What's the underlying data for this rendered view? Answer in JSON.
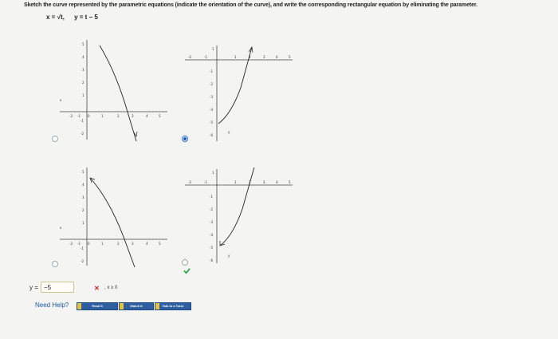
{
  "question": {
    "prompt": "Sketch the curve represented by the parametric equations (indicate the orientation of the curve), and write the corresponding rectangular equation by eliminating the parameter.",
    "eq_x": "x = √t,",
    "eq_y": "y = t − 5"
  },
  "graphs": [
    {
      "id": "A",
      "selected": false,
      "x_ticks": [
        "-2",
        "-1",
        "0",
        "1",
        "2",
        "3",
        "4",
        "5"
      ],
      "y_ticks": [
        "5",
        "4",
        "3",
        "2",
        "1",
        "-1",
        "-2"
      ],
      "x_axis_label": "x",
      "y_axis_label": "y"
    },
    {
      "id": "B",
      "selected": true,
      "x_ticks": [
        "-2",
        "-1",
        "1",
        "2",
        "3",
        "4",
        "5"
      ],
      "y_ticks": [
        "1",
        "-1",
        "-2",
        "-3",
        "-4",
        "-5",
        "-6"
      ],
      "x_axis_label": "x",
      "y_axis_label": "y"
    },
    {
      "id": "C",
      "selected": false,
      "x_ticks": [
        "-2",
        "-1",
        "0",
        "1",
        "2",
        "3",
        "4",
        "5"
      ],
      "y_ticks": [
        "5",
        "4",
        "3",
        "2",
        "1",
        "-1",
        "-2"
      ],
      "x_axis_label": "x",
      "y_axis_label": "y"
    },
    {
      "id": "D",
      "selected": false,
      "x_ticks": [
        "-2",
        "-1",
        "1",
        "2",
        "3",
        "4",
        "5"
      ],
      "y_ticks": [
        "1",
        "-1",
        "-2",
        "-3",
        "-4",
        "-5",
        "-6"
      ],
      "x_axis_label": "x",
      "y_axis_label": "y"
    }
  ],
  "answer": {
    "lhs": "y =",
    "value": "−5",
    "status_mark": "✕",
    "restriction": ", x ≥ 0"
  },
  "help": {
    "label": "Need Help?",
    "read_it": "Read It",
    "watch_it": "Watch It",
    "talk_to_tutor": "Talk to a Tutor"
  },
  "colors": {
    "selected_radio": "#1b5fd0",
    "correct": "#2aa14a",
    "wrong": "#d02020",
    "button": "#2f5fa0"
  }
}
